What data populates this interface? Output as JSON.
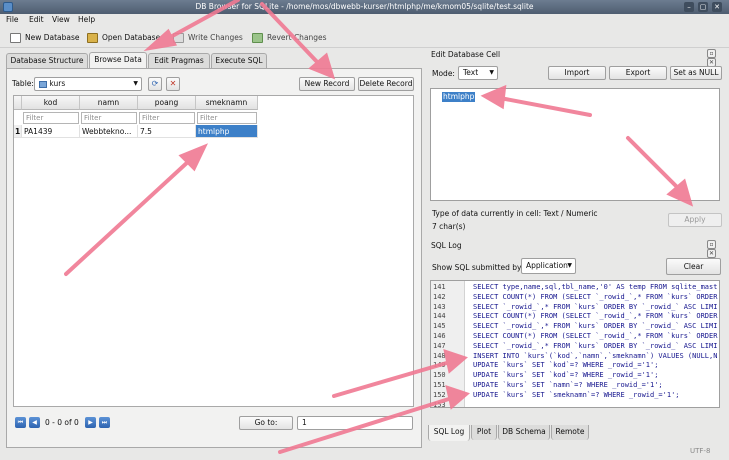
{
  "window": {
    "title": "DB Browser for SQLite - /home/mos/dbwebb-kurser/htmlphp/me/kmom05/sqlite/test.sqlite"
  },
  "menu": [
    "File",
    "Edit",
    "View",
    "Help"
  ],
  "toolbar": {
    "new_db": "New Database",
    "open_db": "Open Database",
    "write": "Write Changes",
    "revert": "Revert Changes"
  },
  "main_tabs": [
    "Database Structure",
    "Browse Data",
    "Edit Pragmas",
    "Execute SQL"
  ],
  "browse": {
    "table_label": "Table:",
    "table_value": "kurs",
    "new_record": "New Record",
    "delete_record": "Delete Record",
    "columns": [
      "kod",
      "namn",
      "poang",
      "smeknamn"
    ],
    "filter_placeholder": "Filter",
    "row_number": "1",
    "row": [
      "PA1439",
      "Webbtekno...",
      "7.5",
      "htmlphp"
    ],
    "pager": "0 - 0 of 0",
    "goto_label": "Go to:",
    "goto_value": "1"
  },
  "edit_cell": {
    "title": "Edit Database Cell",
    "mode_label": "Mode:",
    "mode_value": "Text",
    "import": "Import",
    "export": "Export",
    "set_null": "Set as NULL",
    "content": "htmlphp",
    "type_info": "Type of data currently in cell: Text / Numeric",
    "size_info": "7 char(s)",
    "apply": "Apply"
  },
  "sql_log": {
    "title": "SQL Log",
    "show_label": "Show SQL submitted by",
    "source": "Application",
    "clear": "Clear",
    "lines": [
      {
        "n": "141",
        "code": "SELECT type,name,sql,tbl_name,'0' AS temp FROM sqlite_mast"
      },
      {
        "n": "142",
        "code": "SELECT COUNT(*) FROM (SELECT `_rowid_`,* FROM `kurs` ORDER"
      },
      {
        "n": "143",
        "code": "SELECT `_rowid_`,* FROM `kurs` ORDER BY `_rowid_` ASC LIMI"
      },
      {
        "n": "144",
        "code": "SELECT COUNT(*) FROM (SELECT `_rowid_`,* FROM `kurs` ORDER"
      },
      {
        "n": "145",
        "code": "SELECT `_rowid_`,* FROM `kurs` ORDER BY `_rowid_` ASC LIMI"
      },
      {
        "n": "146",
        "code": "SELECT COUNT(*) FROM (SELECT `_rowid_`,* FROM `kurs` ORDER"
      },
      {
        "n": "147",
        "code": "SELECT `_rowid_`,* FROM `kurs` ORDER BY `_rowid_` ASC LIMI"
      },
      {
        "n": "148",
        "code": "INSERT INTO `kurs`(`kod`,`namn`,`smeknamn`) VALUES (NULL,N"
      },
      {
        "n": "149",
        "code": "UPDATE `kurs` SET `kod`=? WHERE _rowid_='1';"
      },
      {
        "n": "150",
        "code": "UPDATE `kurs` SET `kod`=? WHERE _rowid_='1';"
      },
      {
        "n": "151",
        "code": "UPDATE `kurs` SET `namn`=? WHERE _rowid_='1';"
      },
      {
        "n": "152",
        "code": "UPDATE `kurs` SET `smeknamn`=? WHERE _rowid_='1';"
      },
      {
        "n": "153",
        "code": ""
      }
    ],
    "bottom_tabs": [
      "SQL Log",
      "Plot",
      "DB Schema",
      "Remote"
    ]
  },
  "status": {
    "encoding": "UTF-8"
  },
  "colors": {
    "accent": "#3d80c8",
    "annotation_arrow": "#f07a93"
  }
}
